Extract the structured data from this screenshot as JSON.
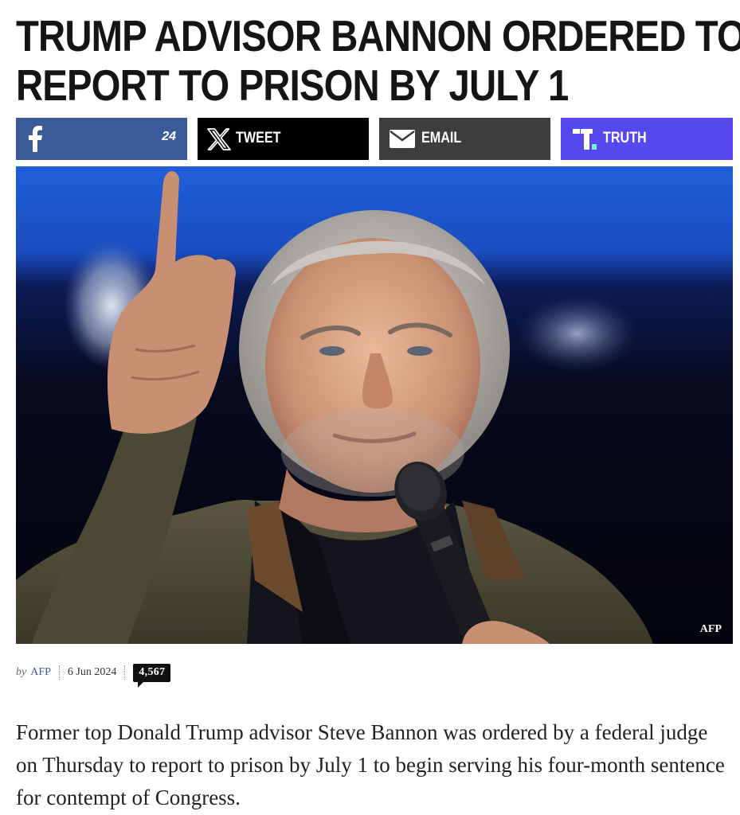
{
  "headline": {
    "line1": "TRUMP ADVISOR BANNON ORDERED TO",
    "line2": "REPORT TO PRISON BY JULY 1"
  },
  "share": {
    "facebook": {
      "icon": "facebook-icon",
      "count": "24",
      "color": "#3a5a98"
    },
    "x": {
      "icon": "x-logo-icon",
      "label": "TWEET",
      "color": "#000000"
    },
    "email": {
      "icon": "envelope-icon",
      "label": "EMAIL",
      "color": "#3d3d3d"
    },
    "truth": {
      "icon": "truth-social-icon",
      "label": "TRUTH",
      "color": "#5448ee"
    }
  },
  "photo": {
    "credit": "AFP"
  },
  "meta": {
    "by": "by",
    "author": "AFP",
    "date": "6 Jun 2024",
    "comment_count": "4,567"
  },
  "lede": "Former top Donald Trump advisor Steve Bannon was ordered by a federal judge on Thursday to report to prison by July 1 to begin serving his four-month sentence for contempt of Congress."
}
